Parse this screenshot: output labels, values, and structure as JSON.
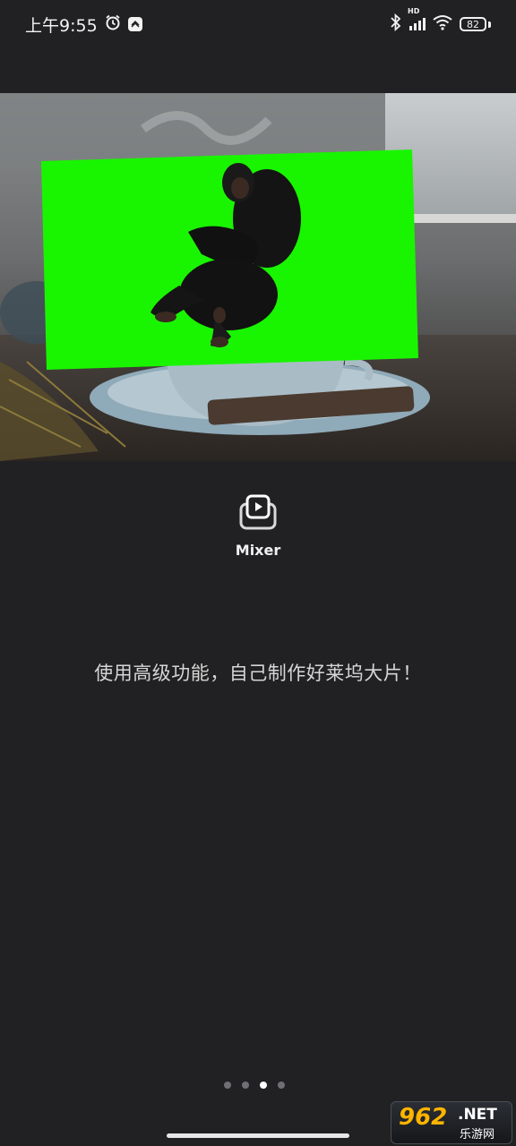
{
  "status_bar": {
    "time": "上午9:55",
    "alarm_icon": "alarm-clock-icon",
    "network_label": "HD",
    "battery": "82"
  },
  "hero": {
    "description_icons": [
      "green-screen-overlay",
      "chimpanzee",
      "coffee-cup"
    ]
  },
  "mixer": {
    "icon": "play-layers-icon",
    "label": "Mixer"
  },
  "tagline": "使用高级功能，自己制作好莱坞大片！",
  "pagination": {
    "total": 4,
    "active_index": 2
  },
  "watermark": {
    "number": "962",
    "suffix": ".NET",
    "cn": "乐游网"
  },
  "colors": {
    "background": "#212123",
    "green_screen": "#19f500",
    "accent_white": "#ffffff"
  }
}
